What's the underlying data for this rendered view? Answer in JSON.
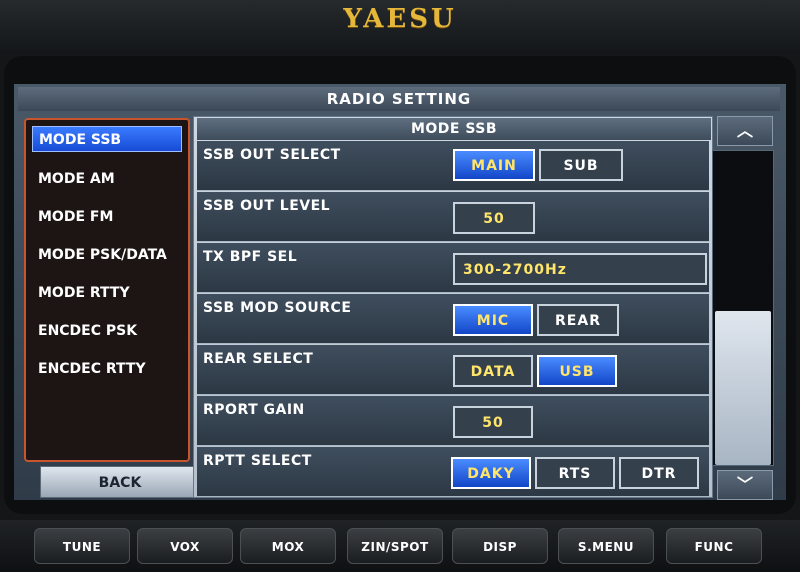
{
  "brand": "YAESU",
  "title": "RADIO SETTING",
  "menu": {
    "items": [
      {
        "label": "MODE SSB",
        "selected": true
      },
      {
        "label": "MODE AM",
        "selected": false
      },
      {
        "label": "MODE FM",
        "selected": false
      },
      {
        "label": "MODE PSK/DATA",
        "selected": false
      },
      {
        "label": "MODE RTTY",
        "selected": false
      },
      {
        "label": "ENCDEC PSK",
        "selected": false
      },
      {
        "label": "ENCDEC RTTY",
        "selected": false
      }
    ],
    "back_label": "BACK"
  },
  "panel": {
    "title": "MODE SSB",
    "rows": [
      {
        "label": "SSB OUT SELECT",
        "options": [
          "MAIN",
          "SUB"
        ],
        "selected": "MAIN"
      },
      {
        "label": "SSB OUT LEVEL",
        "value": "50"
      },
      {
        "label": "TX BPF SEL",
        "value": "300-2700Hz"
      },
      {
        "label": "SSB MOD SOURCE",
        "options": [
          "MIC",
          "REAR"
        ],
        "selected": "MIC"
      },
      {
        "label": "REAR SELECT",
        "options": [
          "DATA",
          "USB"
        ],
        "selected": "USB"
      },
      {
        "label": "RPORT GAIN",
        "value": "50"
      },
      {
        "label": "RPTT SELECT",
        "options": [
          "DAKY",
          "RTS",
          "DTR"
        ],
        "selected": "DAKY"
      }
    ]
  },
  "scroll": {
    "up_icon": "chevron-up-icon",
    "down_icon": "chevron-down-icon",
    "up_glyph": "︿",
    "down_glyph": "﹀"
  },
  "hardware_buttons": [
    "TUNE",
    "VOX",
    "MOX",
    "ZIN/SPOT",
    "DISP",
    "S.MENU",
    "FUNC"
  ],
  "colors": {
    "selected_blue": "#1e5cf0",
    "value_yellow": "#ffe56a",
    "menu_border": "#c8552e"
  }
}
